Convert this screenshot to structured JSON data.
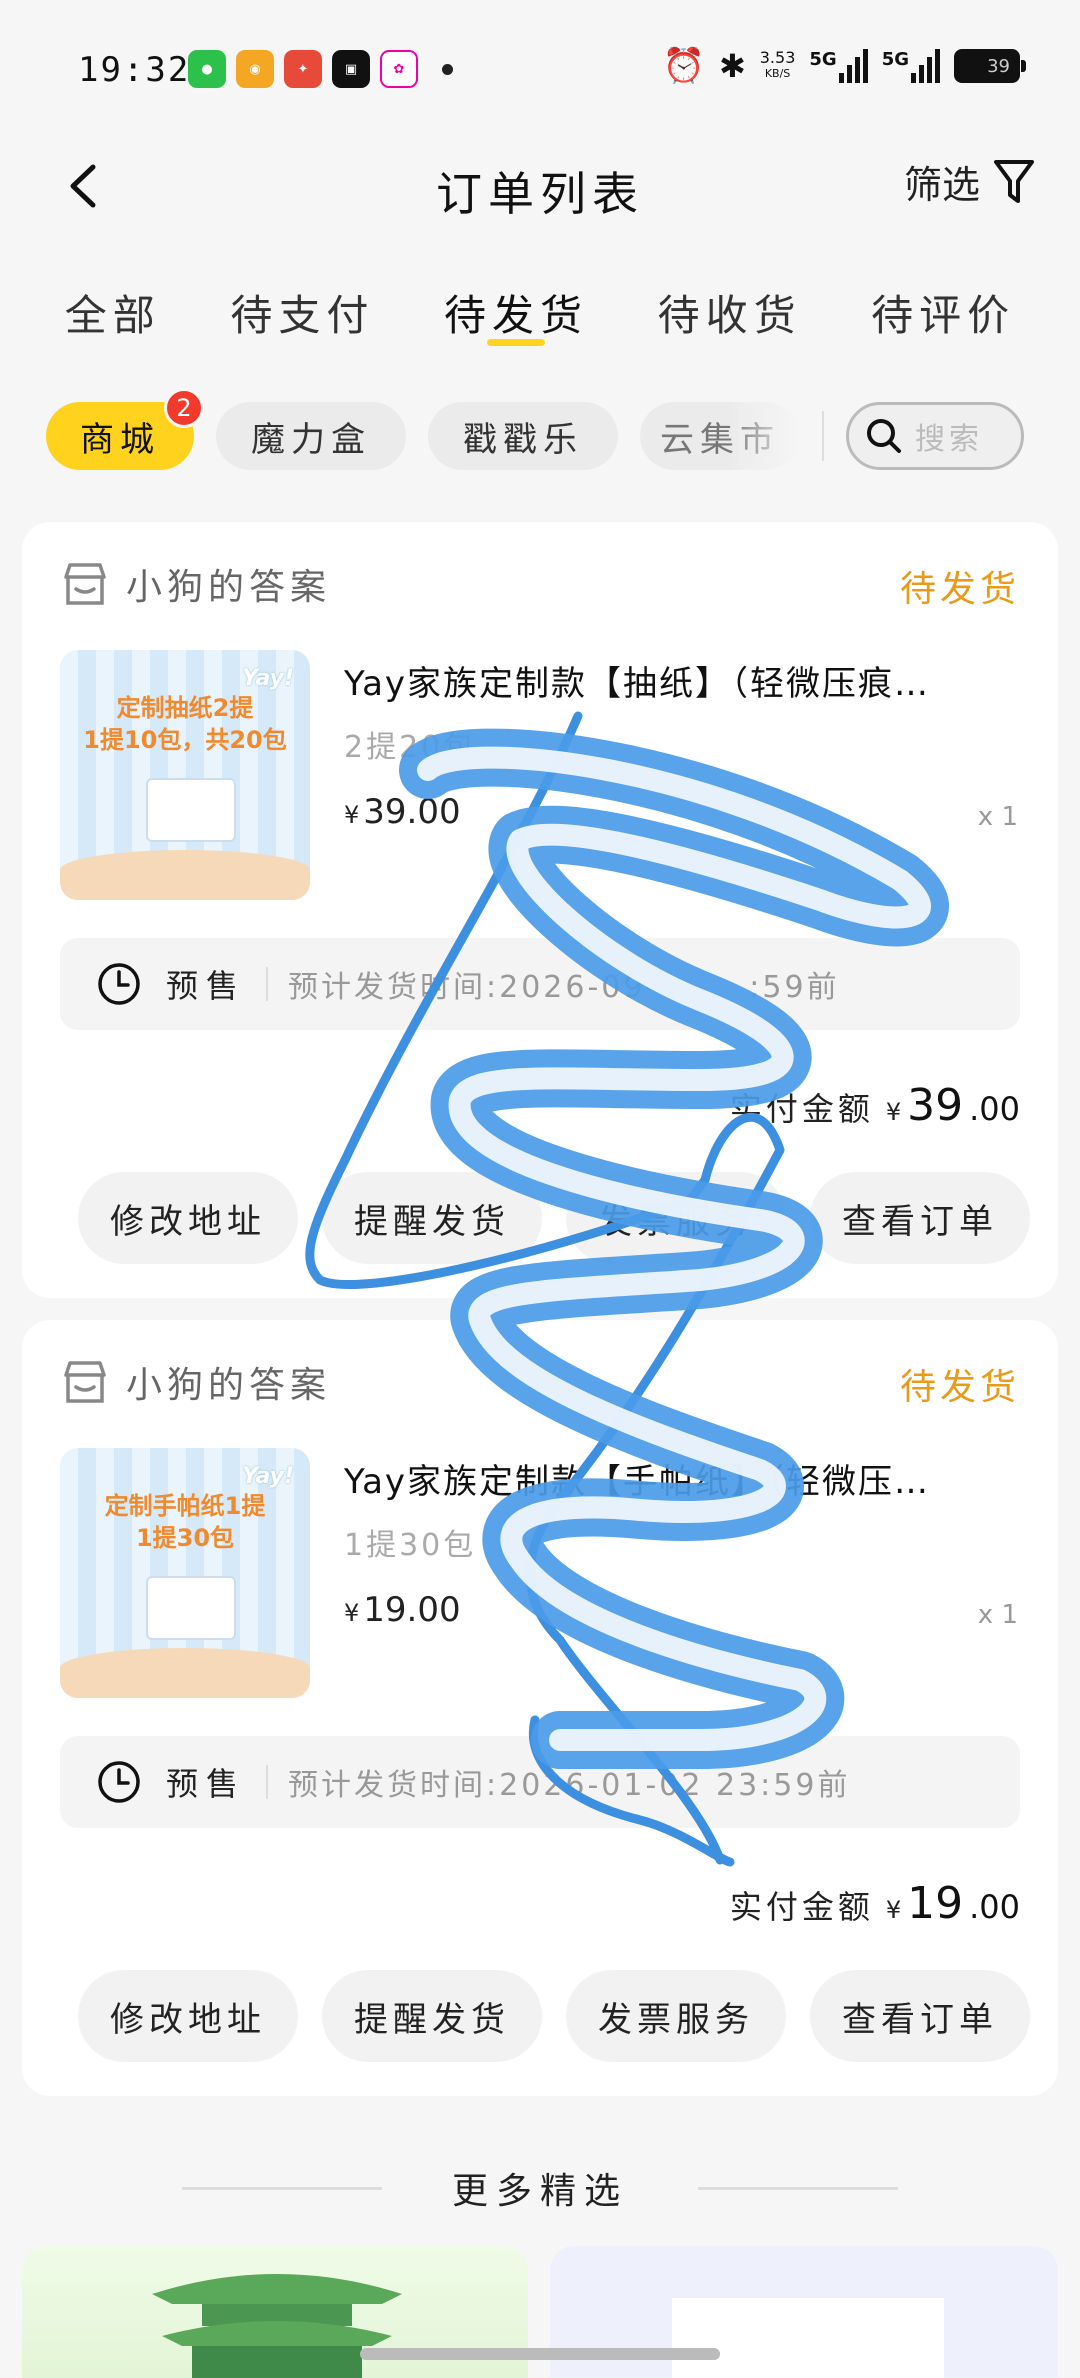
{
  "status_bar": {
    "time": "19:32",
    "net_speed_value": "3.53",
    "net_speed_unit": "KB/S",
    "signal_1": "5G",
    "signal_2": "5G",
    "battery": "39"
  },
  "header": {
    "title": "订单列表",
    "filter_label": "筛选"
  },
  "tabs": [
    {
      "label": "全部"
    },
    {
      "label": "待支付"
    },
    {
      "label": "待发货",
      "active": true
    },
    {
      "label": "待收货"
    },
    {
      "label": "待评价"
    }
  ],
  "chips": [
    {
      "label": "商城",
      "active": true,
      "badge": "2"
    },
    {
      "label": "魔力盒"
    },
    {
      "label": "戳戳乐"
    },
    {
      "label": "云集市"
    }
  ],
  "search": {
    "placeholder": "搜索"
  },
  "orders": [
    {
      "shop_name": "小狗的答案",
      "status": "待发货",
      "product_name": "Yay家族定制款【抽纸】（轻微压痕…",
      "spec": "2提20包",
      "price_symbol": "¥",
      "price": "39.00",
      "qty": "x 1",
      "image_text": "定制抽纸2提\n1提10包，共20包",
      "image_brand": "Yay!",
      "presale_tag": "预售",
      "presale_text": "预计发货时间:2026-09-",
      "presale_time": ":59前",
      "total_label": "实付金额",
      "total_symbol": "¥",
      "total_int": "39",
      "total_dec": ".00",
      "actions": [
        "修改地址",
        "提醒发货",
        "发票服务",
        "查看订单"
      ]
    },
    {
      "shop_name": "小狗的答案",
      "status": "待发货",
      "product_name": "Yay家族定制款【手帕纸】（轻微压…",
      "spec": "1提30包",
      "price_symbol": "¥",
      "price": "19.00",
      "qty": "x 1",
      "image_text": "定制手帕纸1提\n1提30包",
      "image_brand": "Yay!",
      "presale_tag": "预售",
      "presale_text": "预计发货时间:2026-01-02 23:59前",
      "total_label": "实付金额",
      "total_symbol": "¥",
      "total_int": "19",
      "total_dec": ".00",
      "actions": [
        "修改地址",
        "提醒发货",
        "发票服务",
        "查看订单"
      ]
    }
  ],
  "more": {
    "title": "更多精选"
  },
  "colors": {
    "accent_yellow": "#ffd21e",
    "status_orange": "#e89a18",
    "badge_red": "#f13a2c",
    "scribble_blue": "#3d8fe0"
  }
}
